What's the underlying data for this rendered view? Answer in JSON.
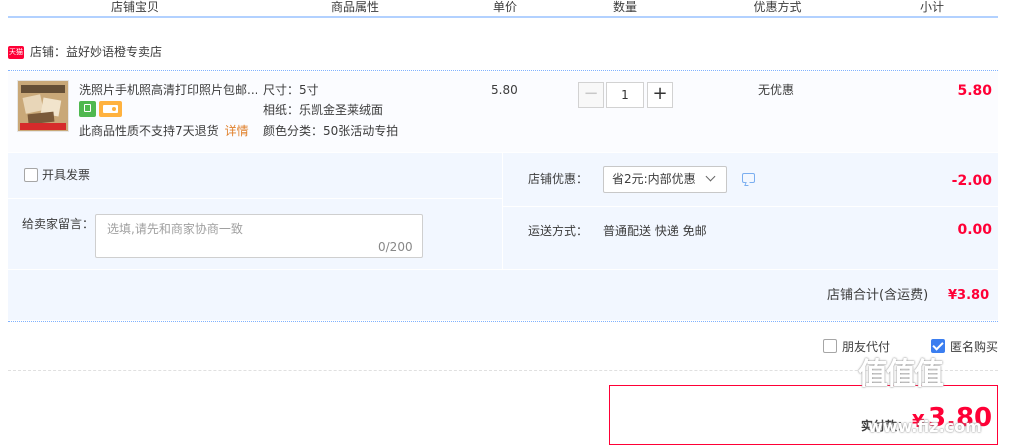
{
  "header": {
    "columns": [
      "店铺宝贝",
      "商品属性",
      "单价",
      "数量",
      "优惠方式",
      "小计"
    ]
  },
  "store": {
    "badge": "天猫",
    "label": "店铺：益好妙语橙专卖店"
  },
  "item": {
    "title": "洗照片手机照高清打印照片包邮...",
    "return_note": "此商品性质不支持7天退货",
    "return_link": "详情",
    "attrs": [
      "尺寸：5寸",
      "相纸：乐凯金圣莱绒面",
      "颜色分类：50张活动专拍"
    ],
    "unit_price": "5.80",
    "quantity": "1",
    "minus": "−",
    "plus": "+",
    "discount_method": "无优惠",
    "subtotal": "5.80"
  },
  "options": {
    "invoice_label": "开具发票",
    "message_label": "给卖家留言：",
    "message_placeholder": "选填,请先和商家协商一致",
    "message_count": "0/200",
    "promo_label": "店铺优惠：",
    "promo_selected": "省2元:内部优惠",
    "promo_value": "-2.00",
    "shipping_label": "运送方式：",
    "shipping_value": "普通配送 快递 免邮",
    "shipping_fee": "0.00"
  },
  "summary": {
    "label": "店铺合计(含运费)",
    "value": "¥3.80"
  },
  "checkout": {
    "friend_pay_label": "朋友代付",
    "anonymous_label": "匿名购买",
    "anonymous_checked": true,
    "pay_label": "实付款：",
    "pay_currency": "¥",
    "pay_amount": "3.80"
  },
  "watermark": {
    "logo": "值值值",
    "site": "www.fiz.com"
  },
  "colors": {
    "accent_red": "#ff0036",
    "header_line": "#b2d1ff",
    "panel_bg": "#f2f7ff",
    "check_blue": "#3b7ef0"
  },
  "icons": [
    "tmall-badge",
    "service-icon-green",
    "card-icon",
    "chevron-down-icon",
    "chat-icon",
    "checkbox-icon"
  ]
}
